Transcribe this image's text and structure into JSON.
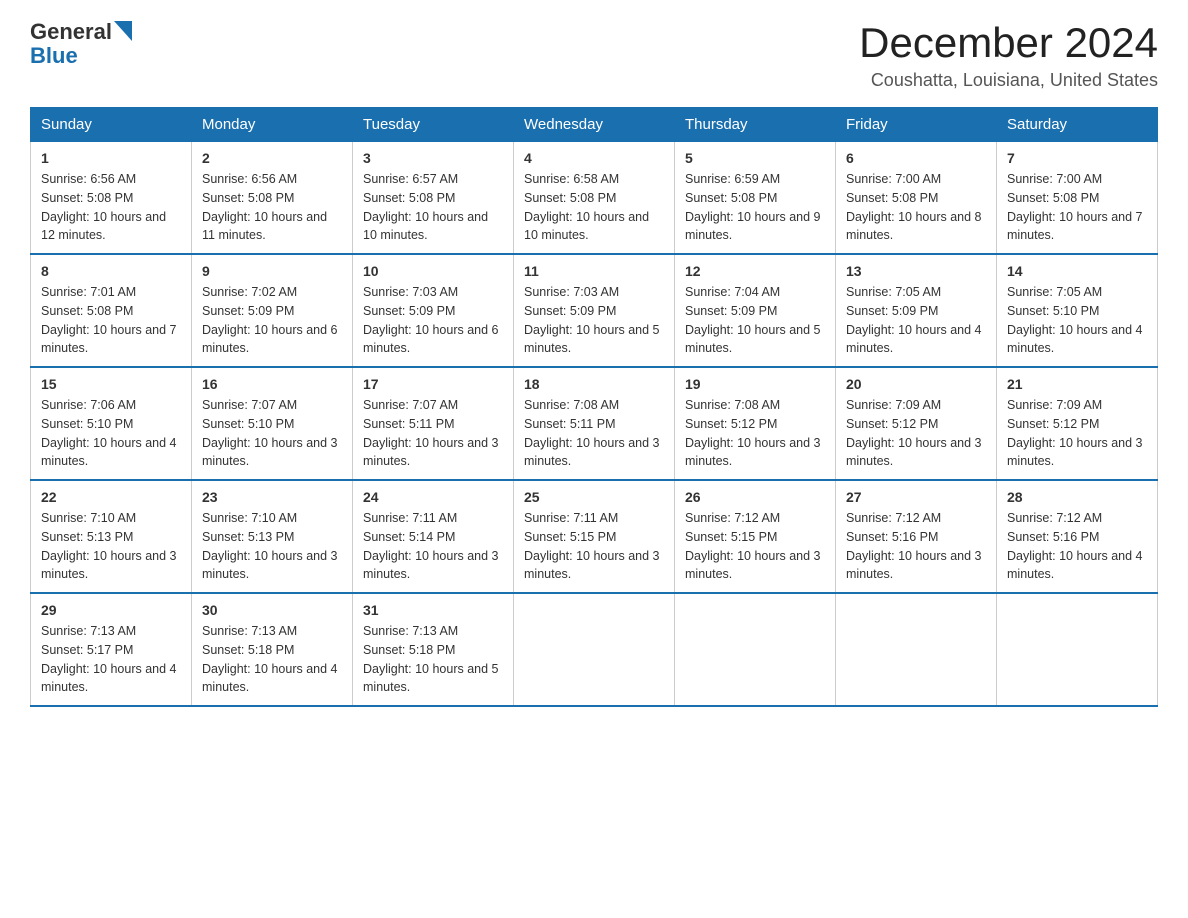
{
  "header": {
    "logo_general": "General",
    "logo_blue": "Blue",
    "month_title": "December 2024",
    "location": "Coushatta, Louisiana, United States"
  },
  "days_of_week": [
    "Sunday",
    "Monday",
    "Tuesday",
    "Wednesday",
    "Thursday",
    "Friday",
    "Saturday"
  ],
  "weeks": [
    [
      {
        "day": "1",
        "sunrise": "6:56 AM",
        "sunset": "5:08 PM",
        "daylight": "10 hours and 12 minutes."
      },
      {
        "day": "2",
        "sunrise": "6:56 AM",
        "sunset": "5:08 PM",
        "daylight": "10 hours and 11 minutes."
      },
      {
        "day": "3",
        "sunrise": "6:57 AM",
        "sunset": "5:08 PM",
        "daylight": "10 hours and 10 minutes."
      },
      {
        "day": "4",
        "sunrise": "6:58 AM",
        "sunset": "5:08 PM",
        "daylight": "10 hours and 10 minutes."
      },
      {
        "day": "5",
        "sunrise": "6:59 AM",
        "sunset": "5:08 PM",
        "daylight": "10 hours and 9 minutes."
      },
      {
        "day": "6",
        "sunrise": "7:00 AM",
        "sunset": "5:08 PM",
        "daylight": "10 hours and 8 minutes."
      },
      {
        "day": "7",
        "sunrise": "7:00 AM",
        "sunset": "5:08 PM",
        "daylight": "10 hours and 7 minutes."
      }
    ],
    [
      {
        "day": "8",
        "sunrise": "7:01 AM",
        "sunset": "5:08 PM",
        "daylight": "10 hours and 7 minutes."
      },
      {
        "day": "9",
        "sunrise": "7:02 AM",
        "sunset": "5:09 PM",
        "daylight": "10 hours and 6 minutes."
      },
      {
        "day": "10",
        "sunrise": "7:03 AM",
        "sunset": "5:09 PM",
        "daylight": "10 hours and 6 minutes."
      },
      {
        "day": "11",
        "sunrise": "7:03 AM",
        "sunset": "5:09 PM",
        "daylight": "10 hours and 5 minutes."
      },
      {
        "day": "12",
        "sunrise": "7:04 AM",
        "sunset": "5:09 PM",
        "daylight": "10 hours and 5 minutes."
      },
      {
        "day": "13",
        "sunrise": "7:05 AM",
        "sunset": "5:09 PM",
        "daylight": "10 hours and 4 minutes."
      },
      {
        "day": "14",
        "sunrise": "7:05 AM",
        "sunset": "5:10 PM",
        "daylight": "10 hours and 4 minutes."
      }
    ],
    [
      {
        "day": "15",
        "sunrise": "7:06 AM",
        "sunset": "5:10 PM",
        "daylight": "10 hours and 4 minutes."
      },
      {
        "day": "16",
        "sunrise": "7:07 AM",
        "sunset": "5:10 PM",
        "daylight": "10 hours and 3 minutes."
      },
      {
        "day": "17",
        "sunrise": "7:07 AM",
        "sunset": "5:11 PM",
        "daylight": "10 hours and 3 minutes."
      },
      {
        "day": "18",
        "sunrise": "7:08 AM",
        "sunset": "5:11 PM",
        "daylight": "10 hours and 3 minutes."
      },
      {
        "day": "19",
        "sunrise": "7:08 AM",
        "sunset": "5:12 PM",
        "daylight": "10 hours and 3 minutes."
      },
      {
        "day": "20",
        "sunrise": "7:09 AM",
        "sunset": "5:12 PM",
        "daylight": "10 hours and 3 minutes."
      },
      {
        "day": "21",
        "sunrise": "7:09 AM",
        "sunset": "5:12 PM",
        "daylight": "10 hours and 3 minutes."
      }
    ],
    [
      {
        "day": "22",
        "sunrise": "7:10 AM",
        "sunset": "5:13 PM",
        "daylight": "10 hours and 3 minutes."
      },
      {
        "day": "23",
        "sunrise": "7:10 AM",
        "sunset": "5:13 PM",
        "daylight": "10 hours and 3 minutes."
      },
      {
        "day": "24",
        "sunrise": "7:11 AM",
        "sunset": "5:14 PM",
        "daylight": "10 hours and 3 minutes."
      },
      {
        "day": "25",
        "sunrise": "7:11 AM",
        "sunset": "5:15 PM",
        "daylight": "10 hours and 3 minutes."
      },
      {
        "day": "26",
        "sunrise": "7:12 AM",
        "sunset": "5:15 PM",
        "daylight": "10 hours and 3 minutes."
      },
      {
        "day": "27",
        "sunrise": "7:12 AM",
        "sunset": "5:16 PM",
        "daylight": "10 hours and 3 minutes."
      },
      {
        "day": "28",
        "sunrise": "7:12 AM",
        "sunset": "5:16 PM",
        "daylight": "10 hours and 4 minutes."
      }
    ],
    [
      {
        "day": "29",
        "sunrise": "7:13 AM",
        "sunset": "5:17 PM",
        "daylight": "10 hours and 4 minutes."
      },
      {
        "day": "30",
        "sunrise": "7:13 AM",
        "sunset": "5:18 PM",
        "daylight": "10 hours and 4 minutes."
      },
      {
        "day": "31",
        "sunrise": "7:13 AM",
        "sunset": "5:18 PM",
        "daylight": "10 hours and 5 minutes."
      },
      null,
      null,
      null,
      null
    ]
  ]
}
